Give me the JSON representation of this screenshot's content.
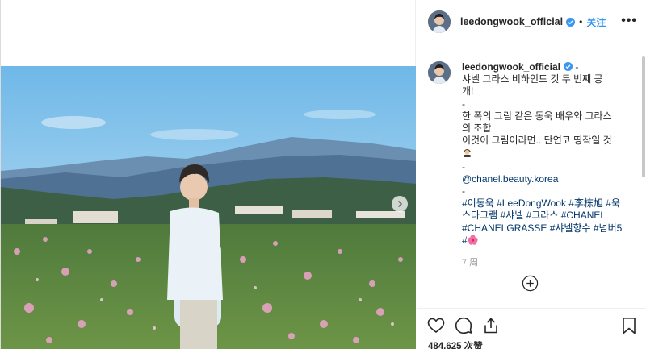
{
  "post": {
    "username": "leedongwook_official",
    "follow_label": "关注",
    "separator": "•",
    "caption": {
      "dash": "-",
      "lines": [
        "샤넬 그라스 비하인드 컷 두 번째 공",
        "개!",
        "-",
        "한 폭의 그림 같은 동욱 배우와 그라스",
        "의 조합",
        "이것이 그림이라면.. 단연코 띵작일 것",
        "-",
        "@chanel.beauty.korea",
        "-",
        "#이동욱 #LeeDongWook #李栋旭 #욱",
        "스타그램 #샤넬 #그라스 #CHANEL",
        "#CHANELGRASSE #샤넬향수 #넘버5",
        "#"
      ],
      "emoji_after_line_6": "artist-emoji",
      "emoji_after_last_line": "hibiscus-emoji"
    },
    "time_ago": "7 周",
    "likes_text": "484,625 次赞"
  },
  "colors": {
    "link": "#3897f0",
    "hashtag": "#003569",
    "muted": "#999999",
    "text": "#262626"
  },
  "icons": {
    "header_more": "more-options-icon",
    "like": "heart-icon",
    "comment": "comment-bubble-icon",
    "share": "share-icon",
    "save": "bookmark-icon",
    "load_more": "plus-circle-icon",
    "carousel_next": "chevron-right-icon",
    "verified": "verified-badge-icon"
  }
}
